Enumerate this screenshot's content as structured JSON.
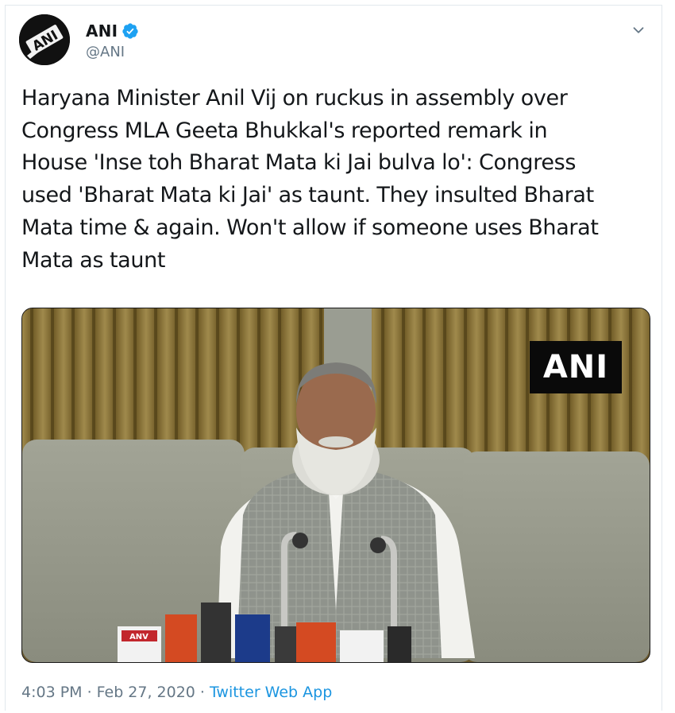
{
  "tweet": {
    "author": {
      "display_name": "ANI",
      "handle": "@ANI",
      "verified": true,
      "avatar_text": "ANI",
      "verified_icon": "verified-badge-icon"
    },
    "text": "Haryana Minister Anil Vij on ruckus in assembly over\nCongress MLA Geeta Bhukkal's reported remark in\nHouse 'Inse toh Bharat Mata ki Jai bulva lo': Congress\nused 'Bharat Mata ki Jai' as taunt. They insulted Bharat\nMata time & again. Won't allow if someone uses Bharat\nMata as taunt",
    "media": {
      "watermark": "ANI",
      "mic_labels": [
        "ANV"
      ]
    },
    "meta": {
      "time": "4:03 PM",
      "separator1": "·",
      "date": "Feb 27, 2020",
      "separator2": "·",
      "source": "Twitter Web App"
    }
  },
  "colors": {
    "text": "#14171a",
    "secondary": "#657786",
    "link": "#1b95e0",
    "verified": "#1da1f2"
  }
}
